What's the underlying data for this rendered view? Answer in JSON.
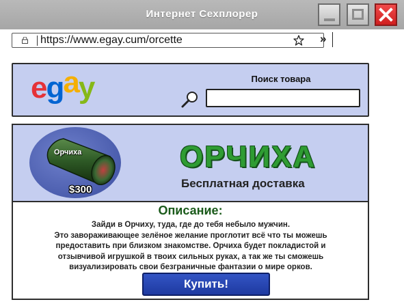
{
  "window": {
    "title": "Интернет Сехплорер"
  },
  "browser": {
    "url": "https://www.egay.cum/orcette",
    "more": "»"
  },
  "site": {
    "logo_letters": [
      "e",
      "g",
      "a",
      "y"
    ],
    "logo_colors": [
      "#e53238",
      "#0064d2",
      "#f5af02",
      "#86b817"
    ],
    "search_label": "Поиск товара",
    "search_value": ""
  },
  "product": {
    "image_label": "Орчиха",
    "price": "$300",
    "name": "ОРЧИХА",
    "shipping": "Бесплатная доставка",
    "description_title": "Описание:",
    "description_lines": [
      "Зайди в Орчиху, туда, где до тебя небыло мужчин.",
      "Это завораживающее зелёное желание проглотит всё что ты можешь",
      "предоставить при близком знакомстве. Орчиха будет покладистой и",
      "отзывчивой игрушкой в твоих сильных руках, а так же ты сможешь",
      "визуализировать свои безграничные фантазии о мире орков."
    ],
    "buy_label": "Купить!"
  },
  "colors": {
    "panel_bg": "#c5cef0",
    "accent_green": "#2f9c33",
    "button_blue": "#2647b5",
    "close_red": "#e02b2b"
  }
}
